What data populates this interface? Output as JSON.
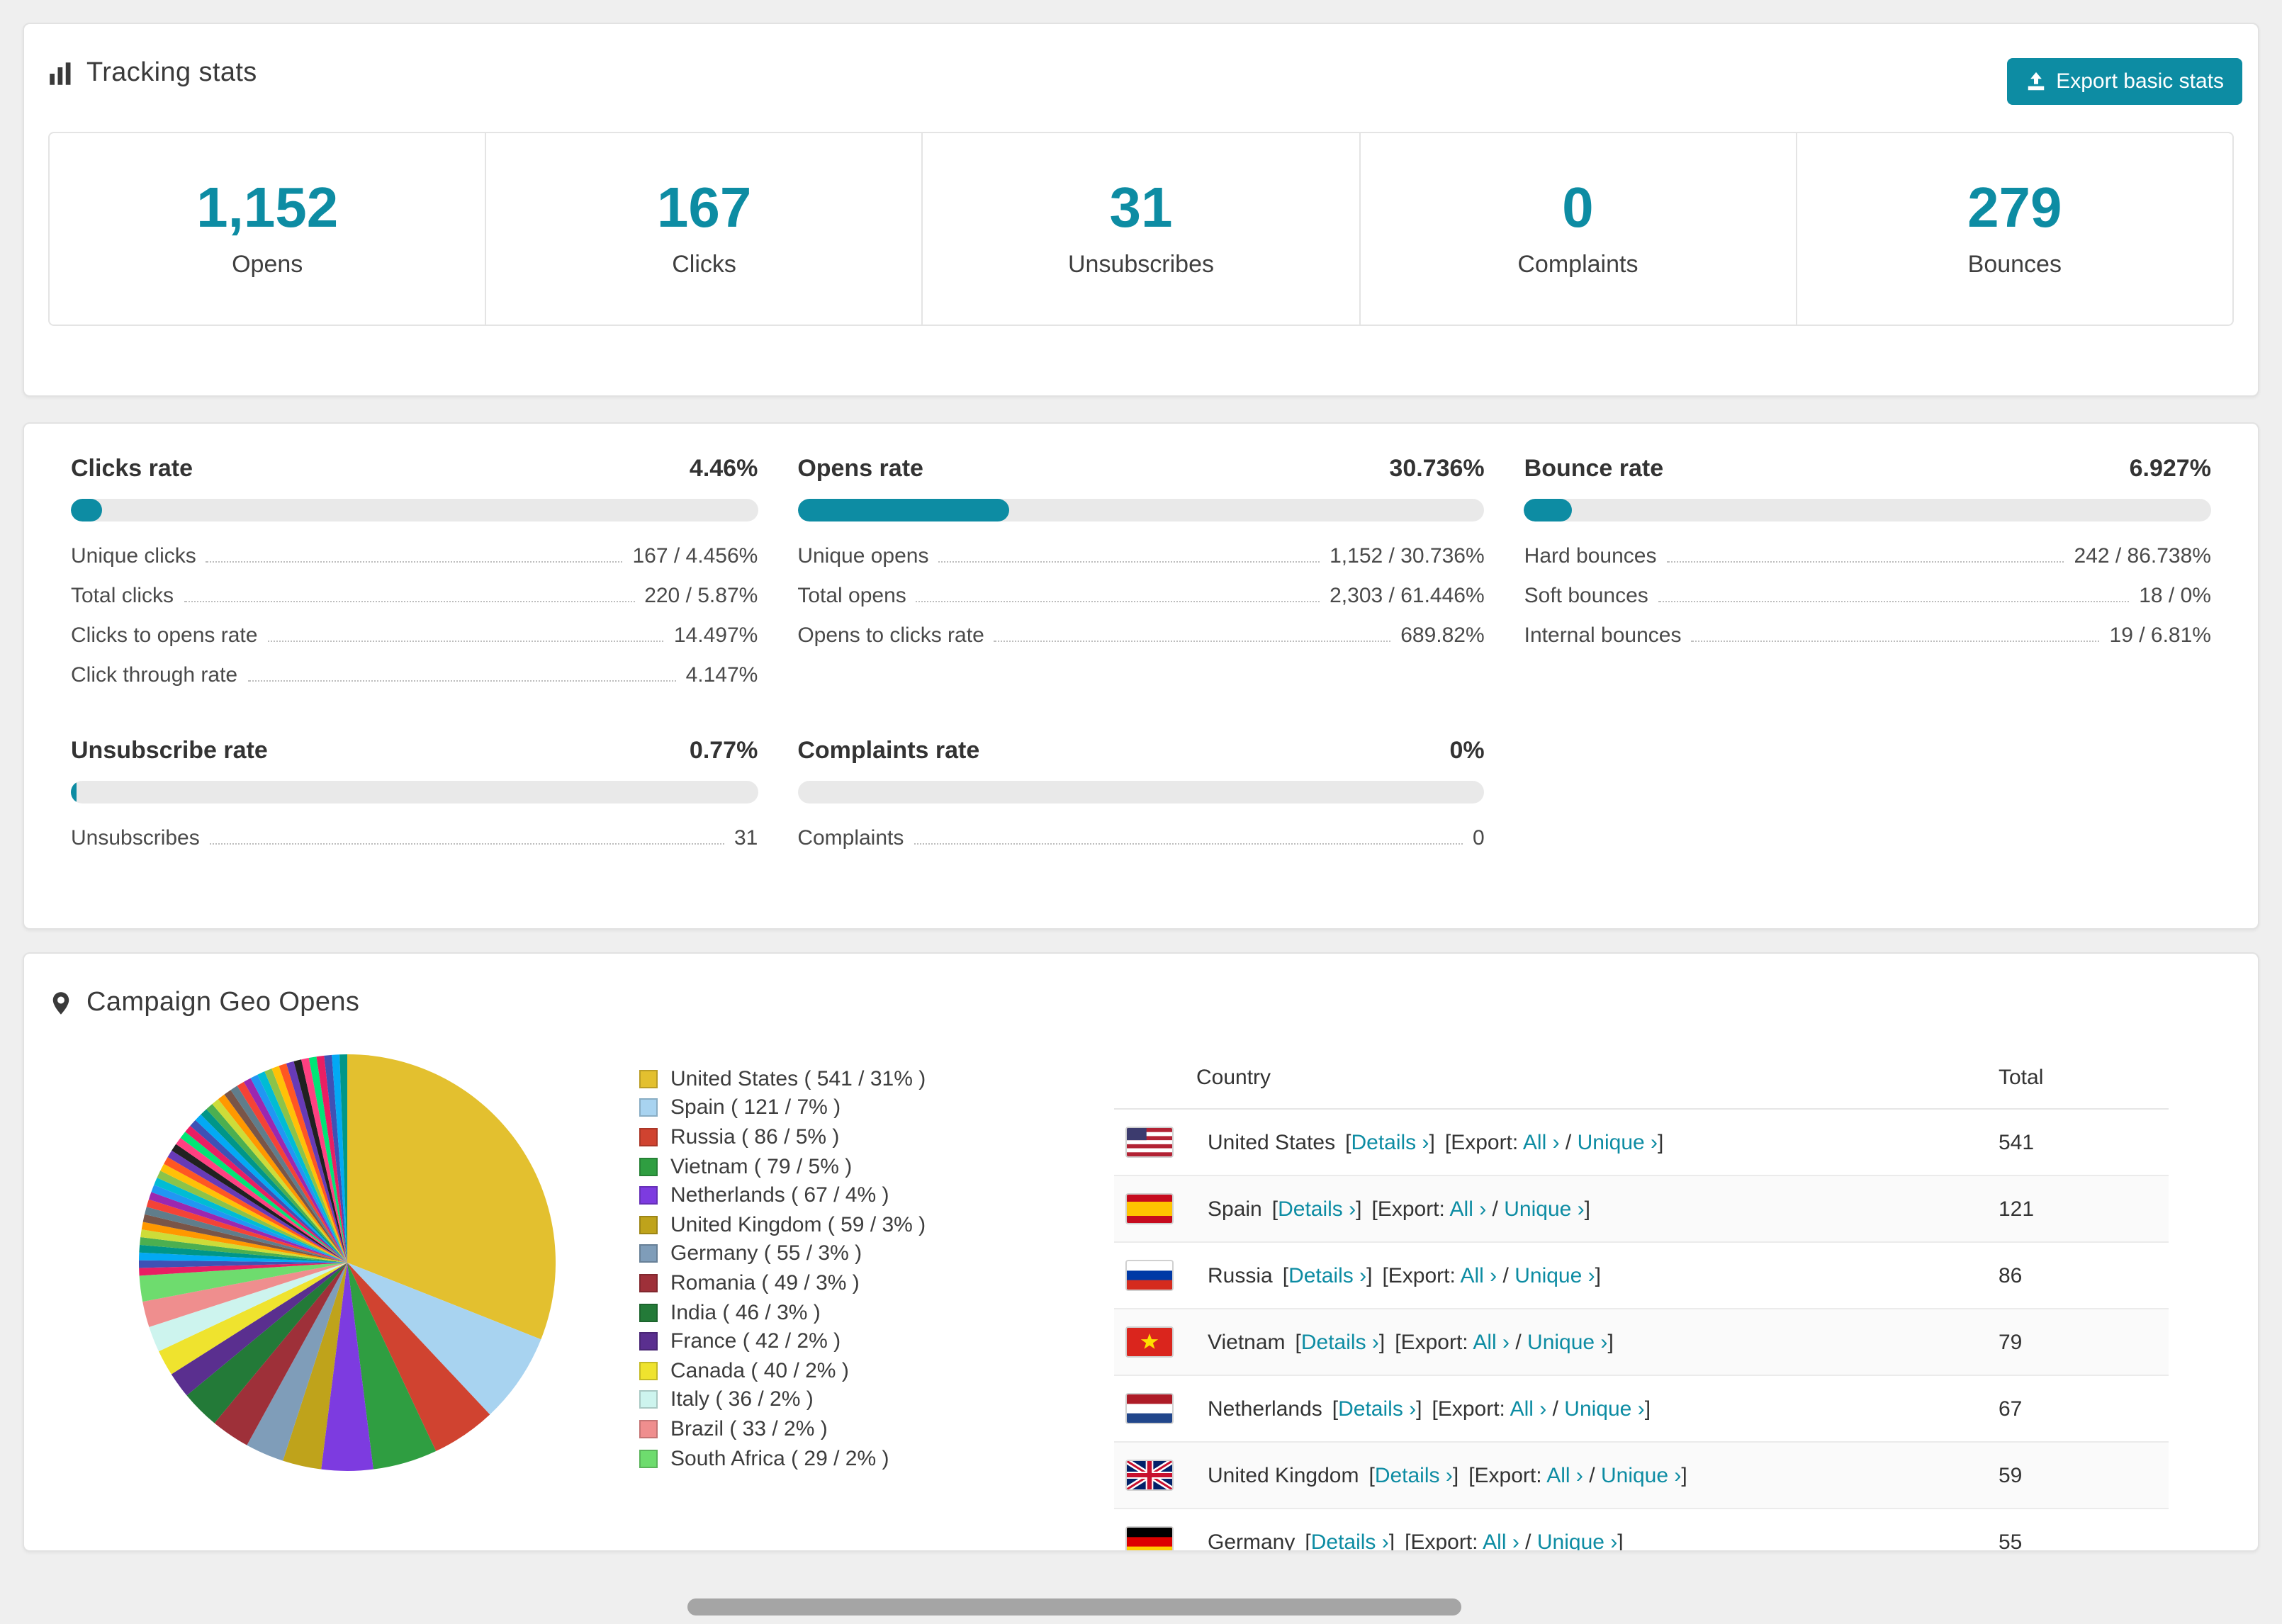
{
  "colors": {
    "accent": "#0d8ca3",
    "page_bg": "#efefef",
    "bar_track": "#e9e9e9"
  },
  "tracking": {
    "title": "Tracking stats",
    "export_button": "Export basic stats",
    "stats": [
      {
        "value": "1,152",
        "label": "Opens"
      },
      {
        "value": "167",
        "label": "Clicks"
      },
      {
        "value": "31",
        "label": "Unsubscribes"
      },
      {
        "value": "0",
        "label": "Complaints"
      },
      {
        "value": "279",
        "label": "Bounces"
      }
    ]
  },
  "rates": [
    {
      "title": "Clicks rate",
      "value": "4.46%",
      "percent": 4.46,
      "rows": [
        {
          "label": "Unique clicks",
          "value": "167 / 4.456%"
        },
        {
          "label": "Total clicks",
          "value": "220 / 5.87%"
        },
        {
          "label": "Clicks to opens rate",
          "value": "14.497%"
        },
        {
          "label": "Click through rate",
          "value": "4.147%"
        }
      ]
    },
    {
      "title": "Opens rate",
      "value": "30.736%",
      "percent": 30.736,
      "rows": [
        {
          "label": "Unique opens",
          "value": "1,152 / 30.736%"
        },
        {
          "label": "Total opens",
          "value": "2,303 / 61.446%"
        },
        {
          "label": "Opens to clicks rate",
          "value": "689.82%"
        }
      ]
    },
    {
      "title": "Bounce rate",
      "value": "6.927%",
      "percent": 6.927,
      "rows": [
        {
          "label": "Hard bounces",
          "value": "242 / 86.738%"
        },
        {
          "label": "Soft bounces",
          "value": "18 / 0%"
        },
        {
          "label": "Internal bounces",
          "value": "19 / 6.81%"
        }
      ]
    },
    {
      "title": "Unsubscribe rate",
      "value": "0.77%",
      "percent": 0.77,
      "rows": [
        {
          "label": "Unsubscribes",
          "value": "31"
        }
      ]
    },
    {
      "title": "Complaints rate",
      "value": "0%",
      "percent": 0,
      "rows": [
        {
          "label": "Complaints",
          "value": "0"
        }
      ]
    }
  ],
  "geo": {
    "title": "Campaign Geo Opens",
    "legend": [
      {
        "color": "#e3c02f",
        "text": "United States ( 541 / 31% )"
      },
      {
        "color": "#a8d3f0",
        "text": "Spain ( 121 / 7% )"
      },
      {
        "color": "#d04330",
        "text": "Russia ( 86 / 5% )"
      },
      {
        "color": "#2f9e41",
        "text": "Vietnam ( 79 / 5% )"
      },
      {
        "color": "#7d3be0",
        "text": "Netherlands ( 67 / 4% )"
      },
      {
        "color": "#bfa31b",
        "text": "United Kingdom ( 59 / 3% )"
      },
      {
        "color": "#7f9db9",
        "text": "Germany ( 55 / 3% )"
      },
      {
        "color": "#9e3039",
        "text": "Romania ( 49 / 3% )"
      },
      {
        "color": "#237a38",
        "text": "India ( 46 / 3% )"
      },
      {
        "color": "#5a2f8f",
        "text": "France ( 42 / 2% )"
      },
      {
        "color": "#efe32e",
        "text": "Canada ( 40 / 2% )"
      },
      {
        "color": "#cdf4ee",
        "text": "Italy ( 36 / 2% )"
      },
      {
        "color": "#ef8e8e",
        "text": "Brazil ( 33 / 2% )"
      },
      {
        "color": "#6edc6e",
        "text": "South Africa ( 29 / 2% )"
      }
    ],
    "table": {
      "headers": {
        "country": "Country",
        "total": "Total"
      },
      "link_labels": {
        "open": "[",
        "close": "]",
        "details": "Details ›",
        "export": "Export:",
        "all": "All ›",
        "slash": "/",
        "unique": "Unique ›"
      },
      "rows": [
        {
          "country": "United States",
          "flag": "us",
          "total": "541"
        },
        {
          "country": "Spain",
          "flag": "es",
          "total": "121"
        },
        {
          "country": "Russia",
          "flag": "ru",
          "total": "86"
        },
        {
          "country": "Vietnam",
          "flag": "vn",
          "total": "79"
        },
        {
          "country": "Netherlands",
          "flag": "nl",
          "total": "67"
        },
        {
          "country": "United Kingdom",
          "flag": "gb",
          "total": "59"
        },
        {
          "country": "Germany",
          "flag": "de",
          "total": "55"
        }
      ]
    }
  },
  "chart_data": {
    "type": "pie",
    "title": "Campaign Geo Opens",
    "labels": [
      "United States",
      "Spain",
      "Russia",
      "Vietnam",
      "Netherlands",
      "United Kingdom",
      "Germany",
      "Romania",
      "India",
      "France",
      "Canada",
      "Italy",
      "Brazil",
      "South Africa"
    ],
    "values": [
      541,
      121,
      86,
      79,
      67,
      59,
      55,
      49,
      46,
      42,
      40,
      36,
      33,
      29
    ],
    "percents": [
      31,
      7,
      5,
      5,
      4,
      3,
      3,
      3,
      3,
      2,
      2,
      2,
      2,
      2
    ],
    "colors": [
      "#e3c02f",
      "#a8d3f0",
      "#d04330",
      "#2f9e41",
      "#7d3be0",
      "#bfa31b",
      "#7f9db9",
      "#9e3039",
      "#237a38",
      "#5a2f8f",
      "#efe32e",
      "#cdf4ee",
      "#ef8e8e",
      "#6edc6e"
    ],
    "others": {
      "percent": 26,
      "slices": 44,
      "colors": [
        "#e91e63",
        "#3f51b5",
        "#03a9f4",
        "#009688",
        "#4caf50",
        "#cddc39",
        "#ff9800",
        "#795548",
        "#607d8b",
        "#f44336",
        "#9c27b0",
        "#2196f3",
        "#00bcd4",
        "#8bc34a",
        "#ffc107",
        "#ff5722",
        "#673ab7",
        "#212121",
        "#ff4081",
        "#00e676"
      ]
    },
    "legend_position": "right",
    "start_angle_deg": 0,
    "direction": "clockwise"
  }
}
